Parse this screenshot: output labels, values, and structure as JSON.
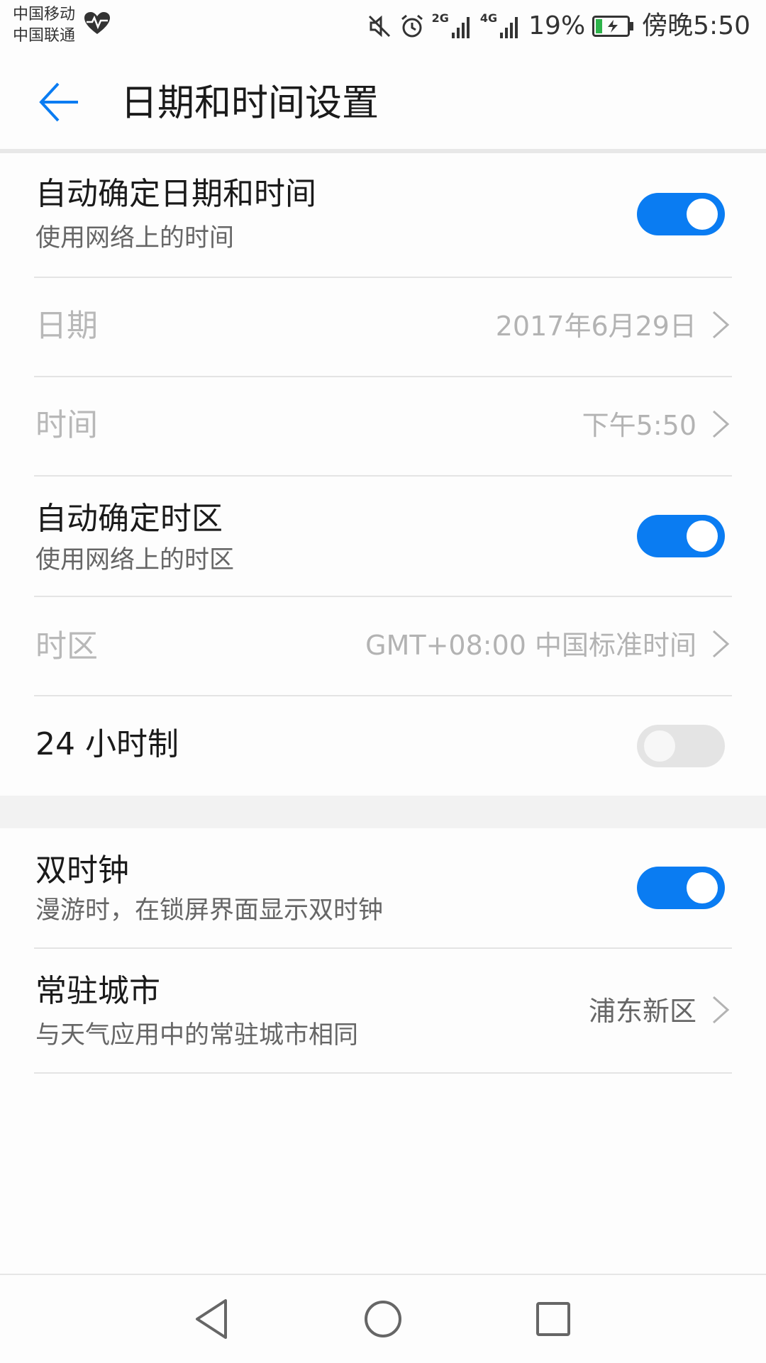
{
  "status_bar": {
    "carrier_1": "中国移动",
    "carrier_2": "中国联通",
    "network_1": "2G",
    "network_2": "4G",
    "battery": "19%",
    "time": "傍晚5:50"
  },
  "header": {
    "title": "日期和时间设置"
  },
  "settings": {
    "auto_datetime": {
      "title": "自动确定日期和时间",
      "subtitle": "使用网络上的时间",
      "enabled": true
    },
    "date": {
      "title": "日期",
      "value": "2017年6月29日"
    },
    "time": {
      "title": "时间",
      "value": "下午5:50"
    },
    "auto_timezone": {
      "title": "自动确定时区",
      "subtitle": "使用网络上的时区",
      "enabled": true
    },
    "timezone": {
      "title": "时区",
      "value": "GMT+08:00 中国标准时间"
    },
    "hour24": {
      "title": "24 小时制",
      "enabled": false
    },
    "dual_clock": {
      "title": "双时钟",
      "subtitle": "漫游时，在锁屏界面显示双时钟",
      "enabled": true
    },
    "home_city": {
      "title": "常驻城市",
      "subtitle": "与天气应用中的常驻城市相同",
      "value": "浦东新区"
    }
  },
  "colors": {
    "accent": "#0a7cf2",
    "toggle_off": "#e4e4e4",
    "disabled_text": "#b8b8b8"
  },
  "icons": {
    "back": "arrow-left-icon",
    "chevron": "chevron-right-icon",
    "nav_back": "triangle-back-icon",
    "nav_home": "circle-home-icon",
    "nav_recent": "square-recent-icon"
  }
}
